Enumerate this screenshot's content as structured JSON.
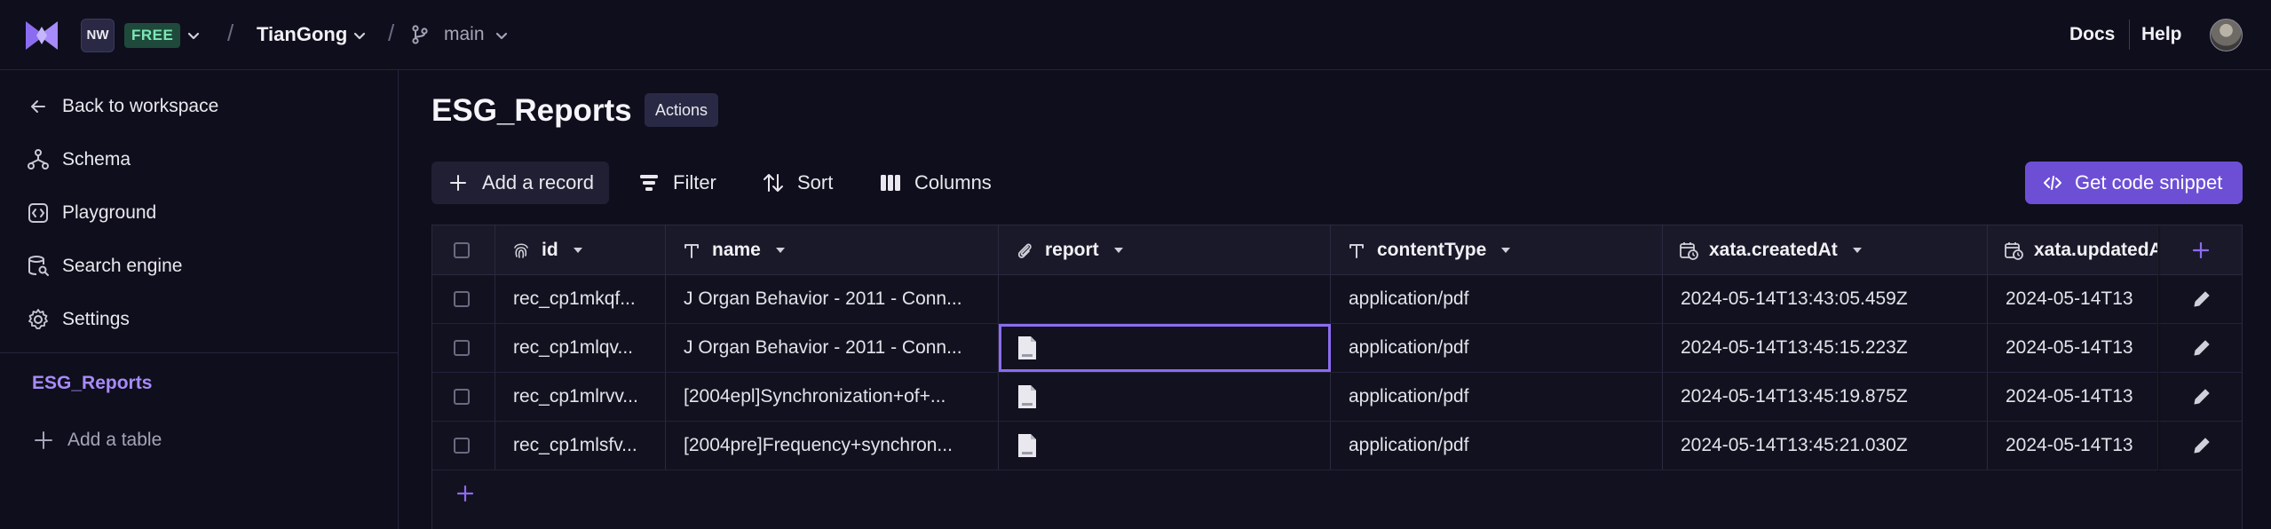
{
  "topbar": {
    "workspace_initials": "NW",
    "plan_badge": "FREE",
    "project": "TianGong",
    "branch": "main",
    "links": {
      "docs": "Docs",
      "help": "Help"
    }
  },
  "sidebar": {
    "items": [
      {
        "label": "Back to workspace",
        "icon": "arrow-left-icon"
      },
      {
        "label": "Schema",
        "icon": "schema-icon"
      },
      {
        "label": "Playground",
        "icon": "code-box-icon"
      },
      {
        "label": "Search engine",
        "icon": "search-database-icon"
      },
      {
        "label": "Settings",
        "icon": "gear-icon"
      }
    ],
    "active_table": "ESG_Reports",
    "add_table_label": "Add a table"
  },
  "main": {
    "title": "ESG_Reports",
    "actions_label": "Actions",
    "toolbar": {
      "add_record": "Add a record",
      "filter": "Filter",
      "sort": "Sort",
      "columns": "Columns",
      "get_code_snippet": "Get code snippet"
    },
    "columns": [
      {
        "label": "id",
        "icon": "fingerprint-icon"
      },
      {
        "label": "name",
        "icon": "text-type-icon"
      },
      {
        "label": "report",
        "icon": "paperclip-icon"
      },
      {
        "label": "contentType",
        "icon": "text-type-icon"
      },
      {
        "label": "xata.createdAt",
        "icon": "calendar-clock-icon"
      },
      {
        "label": "xata.updatedAt",
        "icon": "calendar-clock-icon"
      }
    ],
    "rows": [
      {
        "id": "rec_cp1mkqf...",
        "name": "J Organ Behavior - 2011 - Conn...",
        "report_has_file": false,
        "contentType": "application/pdf",
        "createdAt": "2024-05-14T13:43:05.459Z",
        "updatedAt": "2024-05-14T13"
      },
      {
        "id": "rec_cp1mlqv...",
        "name": "J Organ Behavior - 2011 - Conn...",
        "report_has_file": true,
        "contentType": "application/pdf",
        "createdAt": "2024-05-14T13:45:15.223Z",
        "updatedAt": "2024-05-14T13"
      },
      {
        "id": "rec_cp1mlrvv...",
        "name": "[2004epl]Synchronization+of+...",
        "report_has_file": true,
        "contentType": "application/pdf",
        "createdAt": "2024-05-14T13:45:19.875Z",
        "updatedAt": "2024-05-14T13"
      },
      {
        "id": "rec_cp1mlsfv...",
        "name": "[2004pre]Frequency+synchron...",
        "report_has_file": true,
        "contentType": "application/pdf",
        "createdAt": "2024-05-14T13:45:21.030Z",
        "updatedAt": "2024-05-14T13"
      }
    ],
    "selected_cell": {
      "row": 1,
      "column": "report"
    }
  },
  "colors": {
    "background": "#0f0e1c",
    "accent": "#6d4fd6",
    "active_link": "#a78bfa",
    "selection_outline": "#8b6cf0",
    "free_badge_bg": "#1f4a3b",
    "free_badge_text": "#7ee6b5"
  }
}
